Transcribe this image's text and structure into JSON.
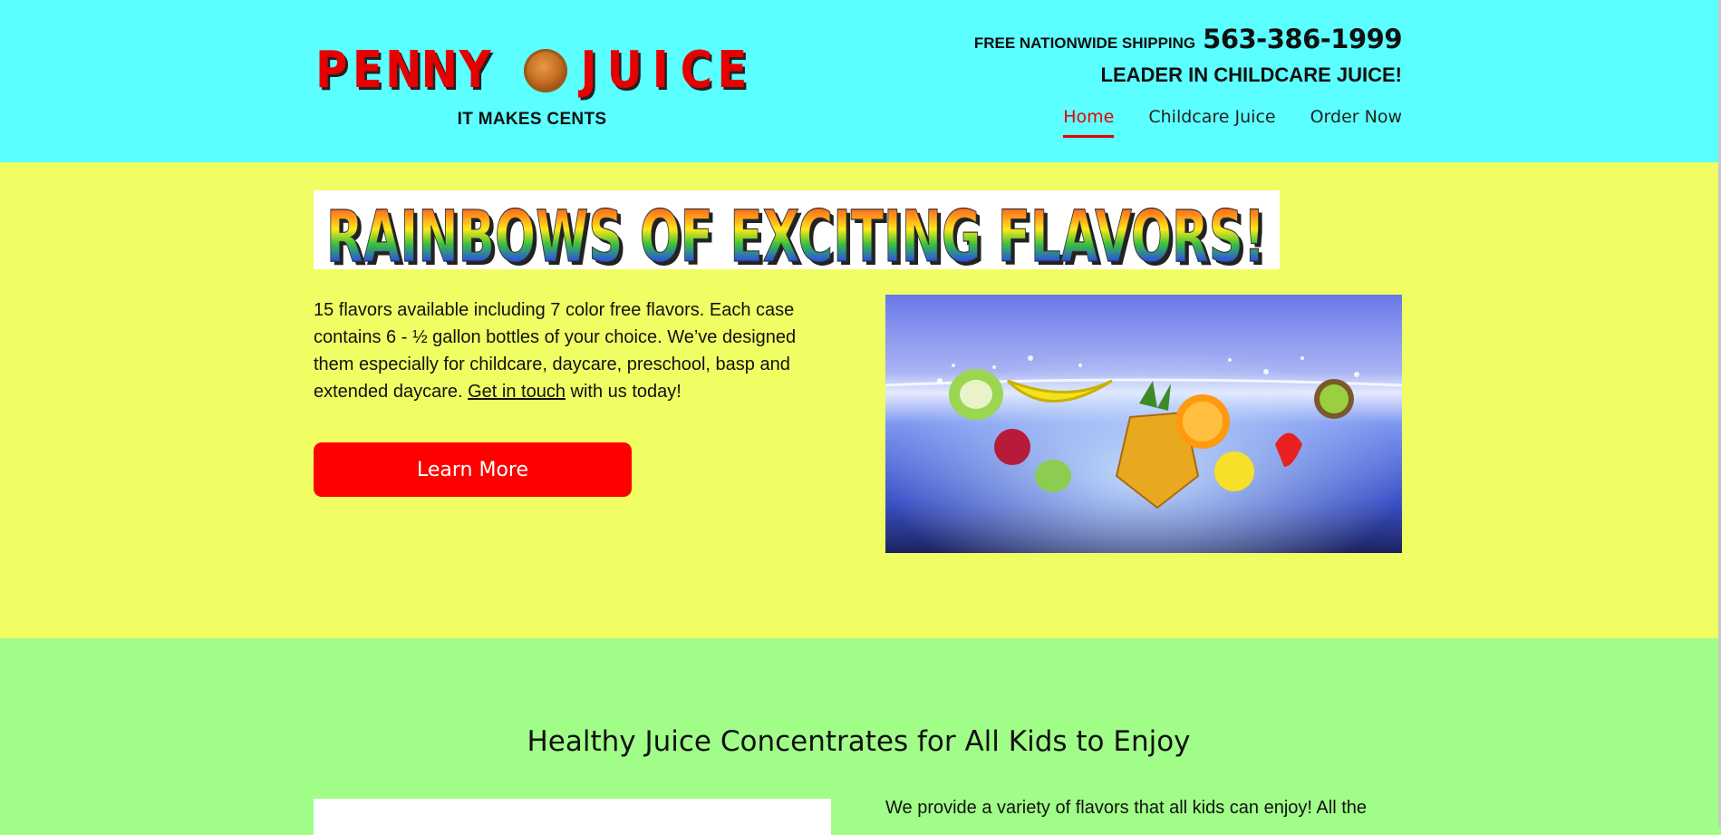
{
  "header": {
    "logo_text": "PENNY JUICE",
    "tagline": "IT MAKES CENTS",
    "shipping": "FREE NATIONWIDE SHIPPING",
    "phone": "563-386-1999",
    "leader": "LEADER IN CHILDCARE JUICE!",
    "nav": [
      {
        "label": "Home",
        "active": true
      },
      {
        "label": "Childcare Juice",
        "active": false
      },
      {
        "label": "Order Now",
        "active": false
      }
    ]
  },
  "hero": {
    "banner_text": "RAINBOWS OF EXCITING FLAVORS!",
    "intro_text": "15 flavors available including 7 color free flavors. Each case contains 6 - ½ gallon bottles of your choice. We’ve designed them especially for childcare, daycare, preschool, basp and extended daycare.",
    "intro_link": "Get in touch",
    "intro_tail": "with us today!",
    "button_label": "Learn More"
  },
  "section2": {
    "title": "Healthy Juice Concentrates for All Kids to Enjoy",
    "text": "We provide a variety of flavors that all kids can enjoy! All the"
  },
  "colors": {
    "header_bg": "#5cffff",
    "hero_bg": "#f0fe64",
    "section2_bg": "#a0fe88",
    "accent": "#ff0000"
  }
}
